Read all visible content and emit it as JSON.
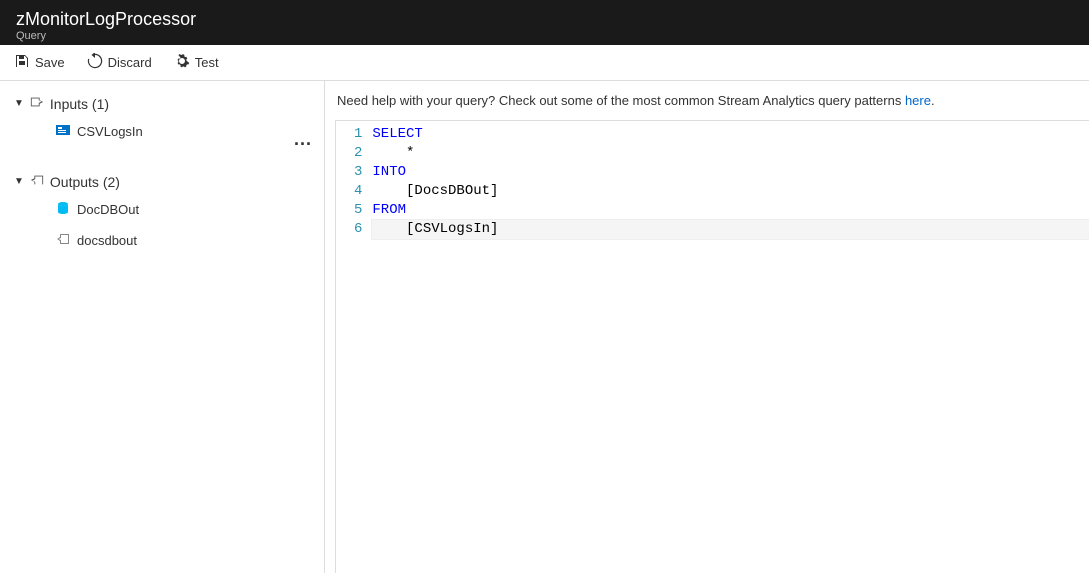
{
  "header": {
    "title": "zMonitorLogProcessor",
    "subtitle": "Query"
  },
  "toolbar": {
    "save_label": "Save",
    "discard_label": "Discard",
    "test_label": "Test"
  },
  "sidebar": {
    "inputs_label": "Inputs (1)",
    "outputs_label": "Outputs (2)",
    "inputs": [
      {
        "label": "CSVLogsIn"
      }
    ],
    "outputs": [
      {
        "label": "DocDBOut"
      },
      {
        "label": "docsdbout"
      }
    ],
    "more_label": "..."
  },
  "help": {
    "prefix": "Need help with your query? Check out some of the most common Stream Analytics query patterns ",
    "link_text": "here",
    "suffix": "."
  },
  "editor": {
    "lines": [
      {
        "num": "1",
        "indent": "",
        "token": "SELECT",
        "type": "kw"
      },
      {
        "num": "2",
        "indent": "    ",
        "token": "*",
        "type": "plain"
      },
      {
        "num": "3",
        "indent": "",
        "token": "INTO",
        "type": "kw"
      },
      {
        "num": "4",
        "indent": "    ",
        "token": "[DocsDBOut]",
        "type": "plain"
      },
      {
        "num": "5",
        "indent": "",
        "token": "FROM",
        "type": "kw"
      },
      {
        "num": "6",
        "indent": "    ",
        "token": "[CSVLogsIn]",
        "type": "plain",
        "current": true
      }
    ]
  }
}
